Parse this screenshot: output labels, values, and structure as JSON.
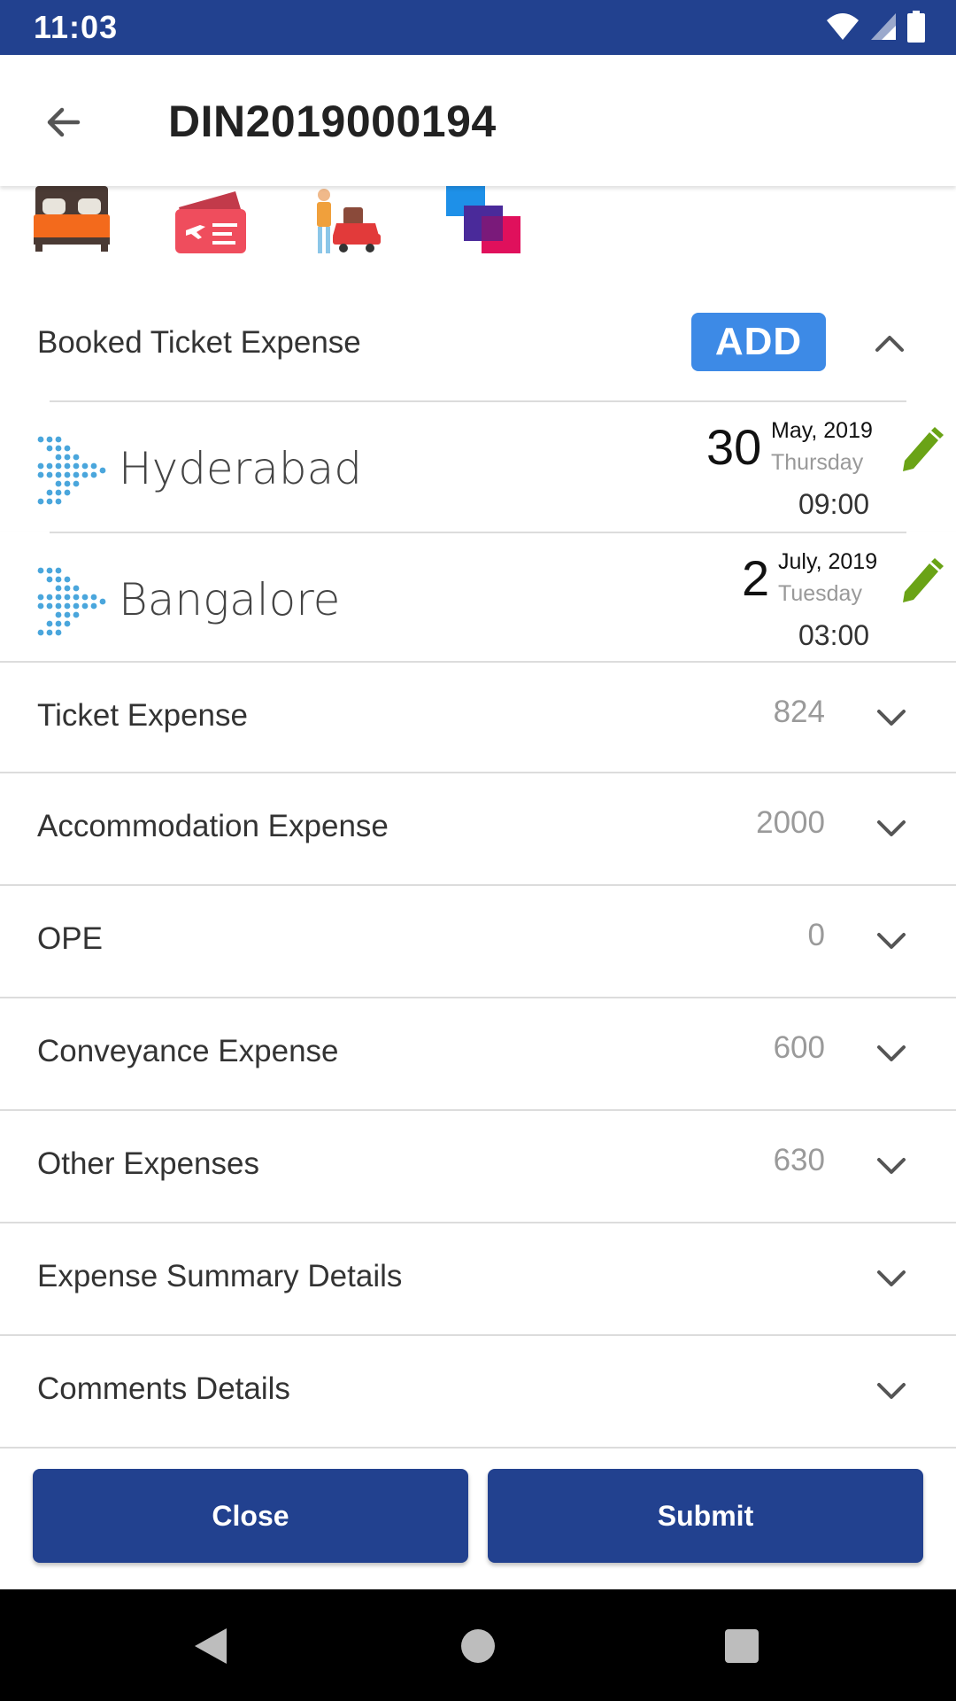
{
  "status_bar": {
    "time": "11:03",
    "icons": [
      "wifi-icon",
      "signal-icon",
      "battery-icon"
    ]
  },
  "app_bar": {
    "back_icon": "arrow-left-icon",
    "title": "DIN2019000194"
  },
  "categories": [
    {
      "name": "bed-icon",
      "label": "Accommodation"
    },
    {
      "name": "ticket-icon",
      "label": "Ticket"
    },
    {
      "name": "traveller-icon",
      "label": "Conveyance"
    },
    {
      "name": "other-icon",
      "label": "Other"
    }
  ],
  "booked_section": {
    "title": "Booked Ticket Expense",
    "add_label": "ADD",
    "collapse_icon": "chevron-up-icon"
  },
  "tickets": [
    {
      "city": "Hyderabad",
      "day": "30",
      "month_year": "May, 2019",
      "weekday": "Thursday",
      "time": "09:00"
    },
    {
      "city": "Bangalore",
      "day": "2",
      "month_year": "July, 2019",
      "weekday": "Tuesday",
      "time": "03:00"
    }
  ],
  "expenses": [
    {
      "label": "Ticket Expense",
      "value": "824"
    },
    {
      "label": "Accommodation Expense",
      "value": "2000"
    },
    {
      "label": "OPE",
      "value": "0"
    },
    {
      "label": "Conveyance Expense",
      "value": "600"
    },
    {
      "label": "Other Expenses",
      "value": "630"
    },
    {
      "label": "Expense Summary Details",
      "value": ""
    },
    {
      "label": "Comments Details",
      "value": ""
    }
  ],
  "actions": {
    "close_label": "Close",
    "submit_label": "Submit"
  },
  "colors": {
    "primary": "#22418f",
    "add_button": "#3d8ae6",
    "edit_icon": "#6aa316"
  }
}
